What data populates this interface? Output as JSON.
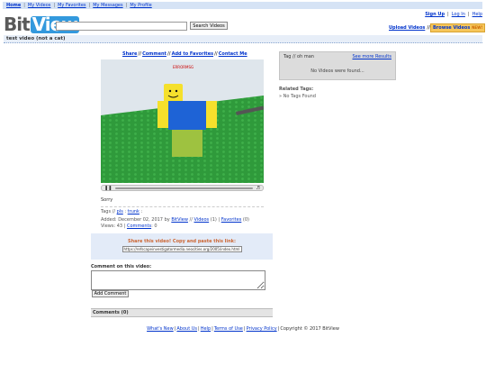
{
  "nav": {
    "links": [
      "Home",
      "My Videos",
      "My Favorites",
      "My Messages",
      "My Profile"
    ],
    "separator": "|"
  },
  "account": {
    "sign_up": "Sign Up",
    "log_in": "Log In",
    "help": "Help",
    "separator": "|"
  },
  "logo": {
    "bit": "Bit",
    "view": "View"
  },
  "search": {
    "query": "",
    "button_label": "Search Videos"
  },
  "header_actions": {
    "upload": "Upload Videos",
    "separator": "//",
    "browse": "Browse Videos",
    "browse_badge": "NEW!"
  },
  "video": {
    "title": "test video (not a cat)",
    "description": "Sorry",
    "tags_label": "Tags //",
    "tags": [
      "pls",
      "trunk"
    ],
    "added_label": "Added: December 02, 2017 by",
    "author": "BitView",
    "videos_link": "Videos",
    "videos_count": "(1)",
    "favorites_link": "Favorites",
    "favorites_count": "(0)",
    "views_label": "Views: 43",
    "comments_link": "Comments",
    "comments_count": ": 0",
    "player_overlay_text": "ERRORMSG"
  },
  "actions": {
    "share": "Share",
    "comment": "Comment",
    "favorites": "Add to Favorites",
    "contact": "Contact Me",
    "separator": "//"
  },
  "share": {
    "header": "Share this video! Copy and paste this link:",
    "url": "https://refscapeinvestigatormedia.neocities.org/2005/index.html"
  },
  "comment": {
    "label": "Comment on this video:",
    "value": "",
    "button": "Add Comment",
    "list_header": "Comments (0)"
  },
  "sidebar": {
    "tag_header": "Tag // oh man",
    "more_results": "See more Results",
    "empty": "No Videos were found...",
    "related_label": "Related Tags:",
    "related_empty": "» No Tags Found"
  },
  "footer": {
    "links": [
      "What's New",
      "About Us",
      "Help",
      "Terms of Use",
      "Privacy Policy"
    ],
    "separator": "|",
    "copyright": "Copyright © 2017 BitView"
  },
  "colors": {
    "link": "#0033cc",
    "nav_bar": "#d6e3f5",
    "logo_blue": "#3399dd",
    "browse_bg": "#f6c65a",
    "share_header": "#cc6633",
    "baseplate": "#2f9a3b",
    "sky": "#dfe6ec"
  }
}
